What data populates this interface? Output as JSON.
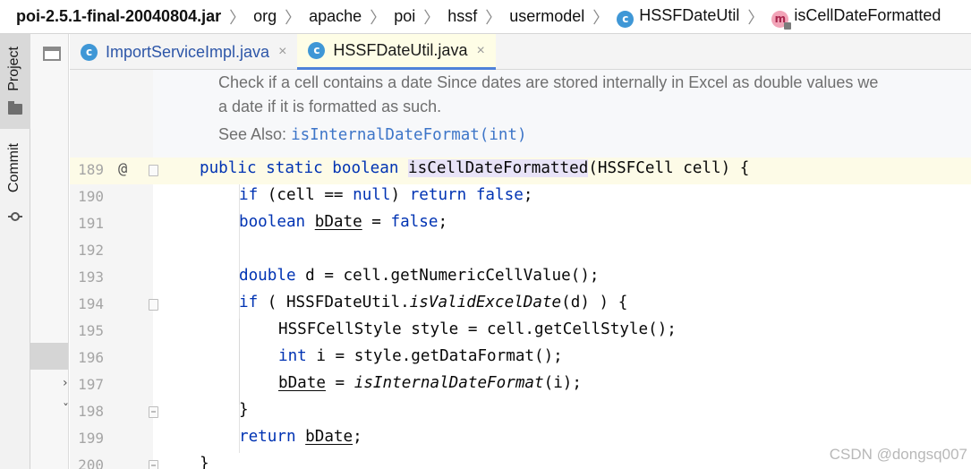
{
  "breadcrumb": {
    "items": [
      "poi-2.5.1-final-20040804.jar",
      "org",
      "apache",
      "poi",
      "hssf",
      "usermodel",
      "HSSFDateUtil",
      "isCellDateFormatted"
    ],
    "separator": "〉"
  },
  "sidebar": {
    "project_label": "Project",
    "commit_label": "Commit"
  },
  "tabs": [
    {
      "label": "ImportServiceImpl.java",
      "close": "×",
      "active": false
    },
    {
      "label": "HSSFDateUtil.java",
      "close": "×",
      "active": true
    }
  ],
  "doc": {
    "line1": "Check if a cell contains a date Since dates are stored internally in Excel as double values we",
    "line2": "a date if it is formatted as such.",
    "see_also_label": "See Also:",
    "see_also_link": "isInternalDateFormat(int)"
  },
  "code": {
    "line_numbers": [
      "189",
      "190",
      "191",
      "192",
      "193",
      "194",
      "195",
      "196",
      "197",
      "198",
      "199",
      "200"
    ],
    "at_marker": "@",
    "l189": {
      "kw": "public static boolean",
      "method": "isCellDateFormatted",
      "rest": "(HSSFCell cell) {"
    },
    "l190": {
      "kw1": "if",
      "mid": " (cell == ",
      "kw2": "null",
      "mid2": ") ",
      "kw3": "return",
      "kw4": "false",
      "end": ";"
    },
    "l191": {
      "kw": "boolean",
      "var": "bDate",
      "mid": " = ",
      "kw2": "false",
      "end": ";"
    },
    "l193": {
      "kw": "double",
      "rest": " d = cell.getNumericCellValue();"
    },
    "l194": {
      "kw": "if",
      "pre": " ( HSSFDateUtil.",
      "italic": "isValidExcelDate",
      "post": "(d) ) {"
    },
    "l195": {
      "text": "HSSFCellStyle style = cell.getCellStyle();"
    },
    "l196": {
      "kw": "int",
      "rest": " i = style.getDataFormat();"
    },
    "l197": {
      "var": "bDate",
      "mid": " = ",
      "italic": "isInternalDateFormat",
      "post": "(i);"
    },
    "l198": {
      "text": "}"
    },
    "l199": {
      "kw": "return",
      "var": "bDate",
      "end": ";"
    },
    "l200": {
      "text": "}"
    }
  },
  "watermark": "CSDN @dongsq007",
  "colors": {
    "keyword": "#0033b3",
    "doc_link": "#3d75c8",
    "active_tab_underline": "#4f82d9",
    "class_badge": "#3f97d6"
  }
}
